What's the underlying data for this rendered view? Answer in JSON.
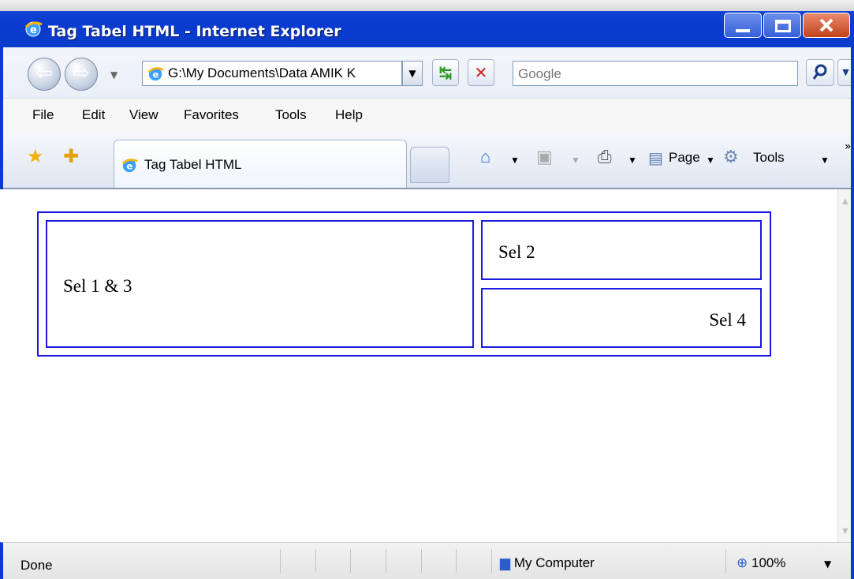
{
  "window": {
    "title": "Tag Tabel HTML - Internet Explorer"
  },
  "nav": {
    "address": "G:\\My Documents\\Data AMIK K",
    "search_placeholder": "Google"
  },
  "menu": [
    "File",
    "Edit",
    "View",
    "Favorites",
    "Tools",
    "Help"
  ],
  "tab": {
    "label": "Tag Tabel HTML"
  },
  "commands": {
    "page_label": "Page",
    "tools_label": "Tools"
  },
  "table": {
    "cell_1_3": "Sel 1 & 3",
    "cell_2": "Sel 2",
    "cell_4": "Sel 4"
  },
  "status": {
    "text": "Done",
    "zone": "My Computer",
    "zoom": "100%"
  },
  "colors": {
    "table_border": "#1a1adf",
    "titlebar": "#0a3bd0"
  },
  "icons": [
    "ie-logo-icon",
    "back-icon",
    "forward-icon",
    "refresh-icon",
    "stop-icon",
    "search-icon",
    "favorites-star-icon",
    "add-favorites-icon",
    "home-icon",
    "feeds-icon",
    "print-icon",
    "page-icon",
    "tools-gear-icon",
    "computer-icon",
    "zoom-icon"
  ]
}
